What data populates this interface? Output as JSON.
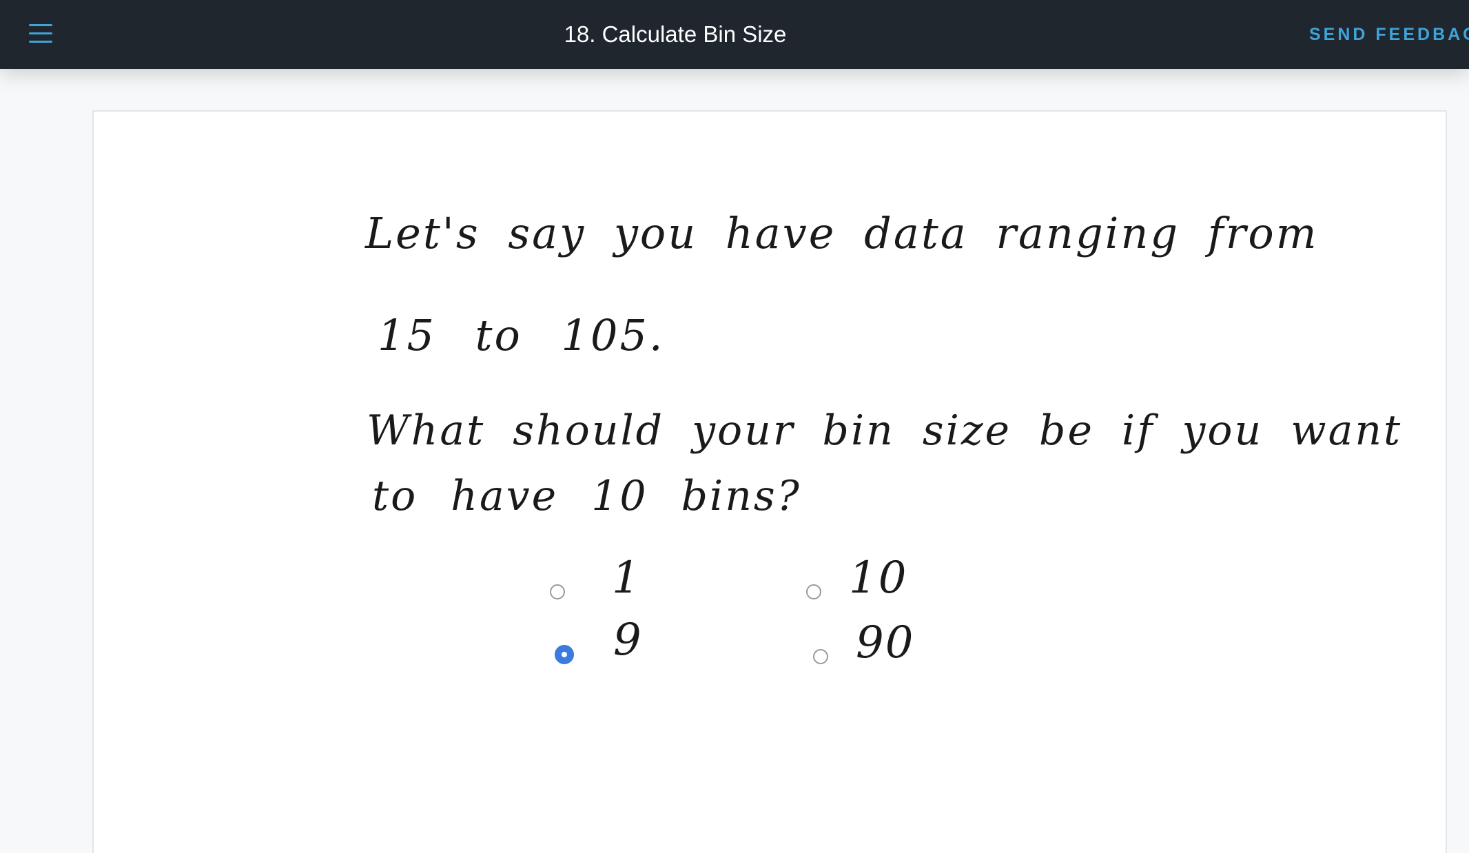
{
  "header": {
    "menu_icon": "hamburger-menu-icon",
    "title": "18. Calculate Bin Size",
    "feedback_label": "SEND FEEDBACK"
  },
  "quiz": {
    "prompt_line_1": "Let's say you have data ranging from",
    "prompt_line_2": "15 to 105.",
    "question_line_1": "What should your bin size be if you want",
    "question_line_2": "to have 10 bins?",
    "options": [
      {
        "label": "1",
        "selected": false
      },
      {
        "label": "10",
        "selected": false
      },
      {
        "label": "9",
        "selected": true
      },
      {
        "label": "90",
        "selected": false
      }
    ]
  },
  "colors": {
    "header_bg": "#1f262e",
    "accent": "#3ea4d9",
    "radio_selected": "#3b7be0"
  }
}
